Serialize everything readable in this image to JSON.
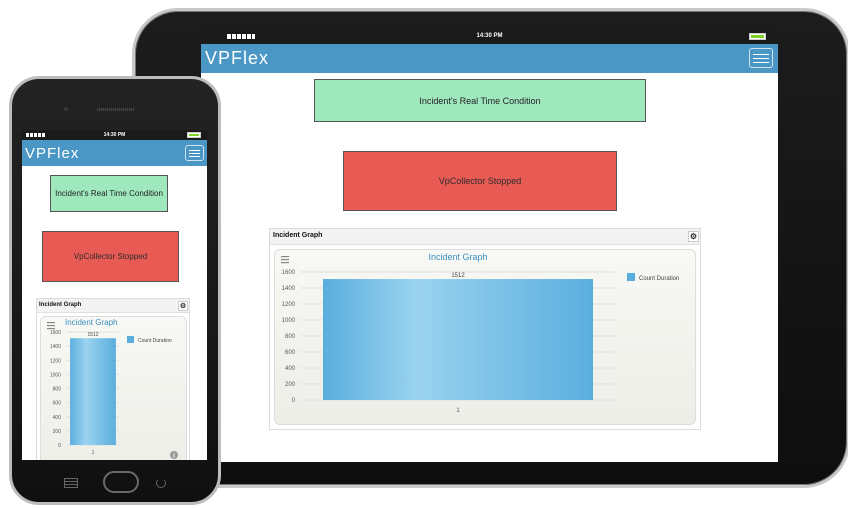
{
  "status_bar": {
    "time": "14:30 PM"
  },
  "app": {
    "brand": "VPFlex"
  },
  "condition_box": {
    "label": "Incident's Real Time Condition"
  },
  "collector_box": {
    "label": "VpCollector Stopped"
  },
  "panel": {
    "title": "Incident Graph"
  },
  "chart_data": {
    "type": "bar",
    "title": "Incident Graph",
    "categories": [
      "1"
    ],
    "series": [
      {
        "name": "Count Duration",
        "values": [
          1512
        ]
      }
    ],
    "data_labels": [
      "1512"
    ],
    "ylim": [
      0,
      1600
    ],
    "yticks": [
      0,
      200,
      400,
      600,
      800,
      1000,
      1200,
      1400,
      1600
    ],
    "grid": true,
    "legend": "top-right",
    "colors": {
      "bar": "#5aaede",
      "bar_highlight": "#9ad3ef"
    }
  },
  "colors": {
    "header": "#4a97c5",
    "condition_box": "#9fe8be",
    "collector_box": "#e85b55"
  },
  "icons": {
    "menu": "hamburger-icon",
    "gear": "gear-icon",
    "chart_menu": "chart-menu-icon",
    "info": "info-icon",
    "home": "home-button-icon"
  }
}
